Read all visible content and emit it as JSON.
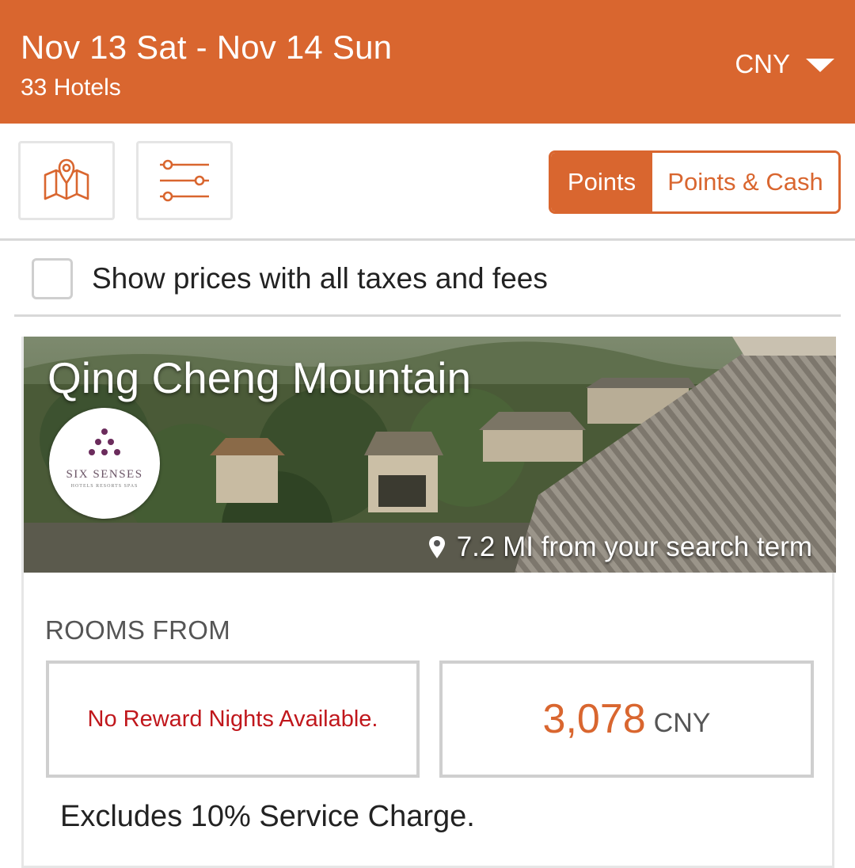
{
  "header": {
    "dates": "Nov 13 Sat - Nov 14 Sun",
    "hotel_count": "33 Hotels",
    "currency": "CNY"
  },
  "toolbar": {
    "map_icon": "map-pin-icon",
    "filter_icon": "sliders-icon",
    "toggle": {
      "points_label": "Points",
      "points_cash_label": "Points & Cash",
      "selected": "Points"
    }
  },
  "taxes_option": {
    "label": "Show prices with all taxes and fees",
    "checked": false
  },
  "hotel": {
    "name": "Qing Cheng Mountain",
    "brand": "SIX SENSES",
    "brand_sub": "HOTELS  RESORTS  SPAS",
    "distance": "7.2 MI from your search term",
    "rooms_from_label": "ROOMS FROM",
    "reward_message": "No Reward Nights Available.",
    "cash_price": "3,078",
    "cash_currency": "CNY",
    "note": "Excludes 10% Service Charge."
  },
  "colors": {
    "accent": "#d9662f",
    "error": "#c0171c"
  }
}
